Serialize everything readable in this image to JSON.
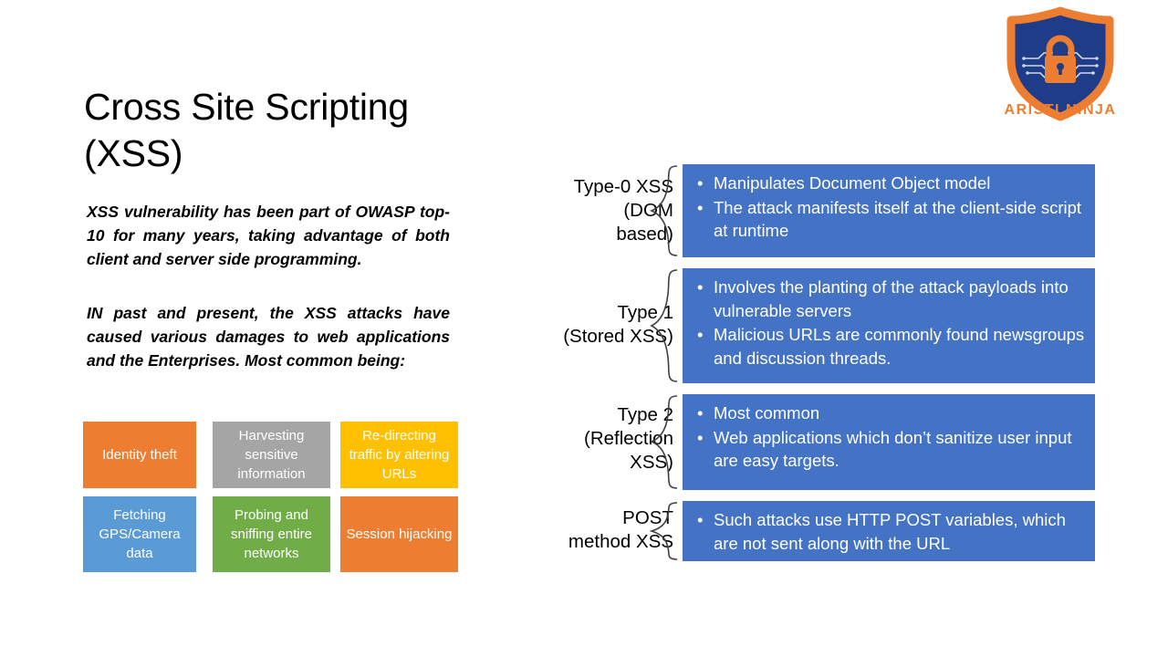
{
  "logo": {
    "name": "aristi-ninja-logo",
    "text": "ARISTI NINJA",
    "shield_fill": "#1F3C88",
    "shield_stroke": "#ED7D31",
    "lock_color": "#ED7D31",
    "text_color": "#ED7D31"
  },
  "slide": {
    "title_line1": "Cross Site Scripting",
    "title_line2": "(XSS)",
    "paragraph1": "XSS vulnerability has been part of OWASP top-10 for many years, taking advantage of both client and server side programming.",
    "paragraph2": "IN past and present, the XSS attacks have caused various damages to web applications and the Enterprises. Most common being:"
  },
  "impact_boxes": [
    {
      "label": "Identity theft",
      "color": "#ED7D31"
    },
    {
      "label": "Harvesting sensitive information",
      "color": "#A5A5A5"
    },
    {
      "label": "Re-directing traffic by altering URLs",
      "color": "#FFC000"
    },
    {
      "label": "Fetching GPS/Camera data",
      "color": "#5B9BD5"
    },
    {
      "label": "Probing and sniffing entire networks",
      "color": "#70AD47"
    },
    {
      "label": "Session hijacking",
      "color": "#ED7D31"
    }
  ],
  "xss_types": [
    {
      "label": "Type-0 XSS (DOM based)",
      "label_lines": [
        "Type-0 XSS",
        "(DOM",
        "based)"
      ],
      "bullets": [
        "Manipulates Document Object model",
        "The attack manifests itself at the client-side script at runtime"
      ]
    },
    {
      "label": "Type 1 (Stored XSS)",
      "label_lines": [
        "Type 1",
        "(Stored XSS)"
      ],
      "bullets": [
        "Involves the planting of the attack payloads into vulnerable servers",
        "Malicious URLs are commonly found newsgroups and discussion threads."
      ]
    },
    {
      "label": "Type 2 (Reflection XSS)",
      "label_lines": [
        "Type 2",
        "(Reflection",
        "XSS)"
      ],
      "bullets": [
        "Most common",
        "Web applications which don’t sanitize user input are easy targets."
      ]
    },
    {
      "label": "POST method XSS",
      "label_lines": [
        "POST",
        "method XSS"
      ],
      "bullets": [
        "Such attacks use HTTP POST variables, which are not sent along with the URL"
      ]
    }
  ],
  "colors": {
    "detail_box": "#4472C4",
    "brace": "#404040"
  }
}
